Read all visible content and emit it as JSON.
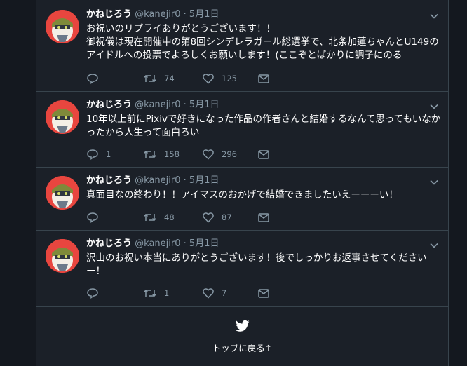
{
  "tweets": [
    {
      "name": "かねじろう",
      "handle": "@kanejir0",
      "dot": "·",
      "date": "5月1日",
      "text": "お祝いのリプライありがとうございます！！\n御祝儀は現在開催中の第8回シンデレラガール総選挙で、北条加蓮ちゃんとU149のアイドルへの投票でよろしくお願いします！(ここぞとばかりに調子にのる",
      "reply_count": "",
      "retweet_count": "74",
      "like_count": "125"
    },
    {
      "name": "かねじろう",
      "handle": "@kanejir0",
      "dot": "·",
      "date": "5月1日",
      "text": "10年以上前にPixivで好きになった作品の作者さんと結婚するなんて思ってもいなかったから人生って面白ろい",
      "reply_count": "1",
      "retweet_count": "158",
      "like_count": "296"
    },
    {
      "name": "かねじろう",
      "handle": "@kanejir0",
      "dot": "·",
      "date": "5月1日",
      "text": "真面目なの終わり！！アイマスのおかげで結婚できましたいえーーーい！",
      "reply_count": "",
      "retweet_count": "48",
      "like_count": "87"
    },
    {
      "name": "かねじろう",
      "handle": "@kanejir0",
      "dot": "·",
      "date": "5月1日",
      "text": "沢山のお祝い本当にありがとうございます！後でしっかりお返事させてくださいー！",
      "reply_count": "",
      "retweet_count": "1",
      "like_count": "7"
    }
  ],
  "footer": {
    "back_to_top": "トップに戻る↑"
  },
  "icons": {
    "reply": "reply-icon",
    "retweet": "retweet-icon",
    "like": "like-icon",
    "dm": "direct-message-icon",
    "more": "chevron-down-icon",
    "bird": "twitter-bird-icon"
  },
  "colors": {
    "background": "#14181f",
    "card": "#1b2028",
    "border": "#38444d",
    "muted": "#8899a6",
    "text": "#ffffff"
  }
}
